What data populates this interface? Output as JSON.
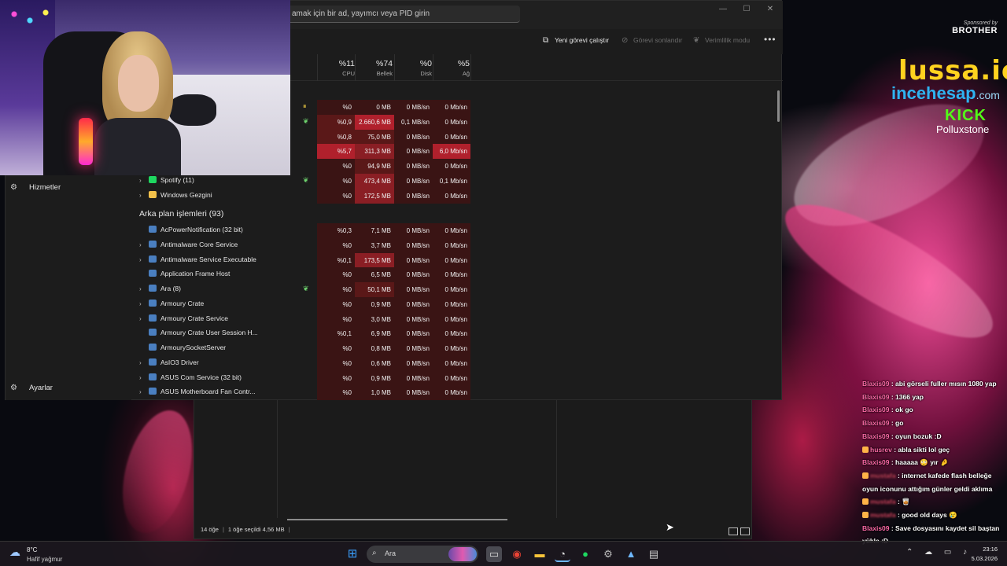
{
  "window": {
    "search_placeholder": "amak için bir ad, yayımcı veya PID girin",
    "minimize": "—",
    "maximize": "☐",
    "close": "✕"
  },
  "toolbar": {
    "new_task": "Yeni görevi çalıştır",
    "end_task": "Görevi sonlandır",
    "efficiency": "Verimlilik modu",
    "more": "•••"
  },
  "nav": {
    "services": "Hizmetler",
    "settings": "Ayarlar"
  },
  "columns": {
    "cpu": {
      "pct": "%11",
      "label": "CPU"
    },
    "memory": {
      "pct": "%74",
      "label": "Bellek"
    },
    "disk": {
      "pct": "%0",
      "label": "Disk"
    },
    "network": {
      "pct": "%5",
      "label": "Ağ"
    }
  },
  "apps_rows": [
    {
      "name": "",
      "status": "pause",
      "cpu": "%0",
      "mem": "0 MB",
      "disk": "0 MB/sn",
      "net": "0 Mb/sn"
    },
    {
      "name": "",
      "status": "leaf",
      "cpu": "%0,9",
      "mem": "2.660,6 MB",
      "disk": "0,1 MB/sn",
      "net": "0 Mb/sn"
    },
    {
      "name": "",
      "status": "",
      "cpu": "%0,8",
      "mem": "75,0 MB",
      "disk": "0 MB/sn",
      "net": "0 Mb/sn"
    },
    {
      "name": "",
      "status": "",
      "cpu": "%5,7",
      "mem": "311,3 MB",
      "disk": "0 MB/sn",
      "net": "6,0 Mb/sn"
    },
    {
      "name": "",
      "status": "",
      "cpu": "%0",
      "mem": "94,9 MB",
      "disk": "0 MB/sn",
      "net": "0 Mb/sn"
    },
    {
      "name": "Spotify (11)",
      "status": "leaf",
      "cpu": "%0",
      "mem": "473,4 MB",
      "disk": "0 MB/sn",
      "net": "0,1 Mb/sn"
    },
    {
      "name": "Windows Gezgini",
      "status": "",
      "cpu": "%0",
      "mem": "172,5 MB",
      "disk": "0 MB/sn",
      "net": "0 Mb/sn"
    }
  ],
  "background_title": "Arka plan işlemleri (93)",
  "background_rows": [
    {
      "name": "AcPowerNotification (32 bit)",
      "expand": false,
      "status": "",
      "cpu": "%0,3",
      "mem": "7,1 MB",
      "disk": "0 MB/sn",
      "net": "0 Mb/sn"
    },
    {
      "name": "Antimalware Core Service",
      "expand": true,
      "status": "",
      "cpu": "%0",
      "mem": "3,7 MB",
      "disk": "0 MB/sn",
      "net": "0 Mb/sn"
    },
    {
      "name": "Antimalware Service Executable",
      "expand": true,
      "status": "",
      "cpu": "%0,1",
      "mem": "173,5 MB",
      "disk": "0 MB/sn",
      "net": "0 Mb/sn"
    },
    {
      "name": "Application Frame Host",
      "expand": false,
      "status": "",
      "cpu": "%0",
      "mem": "6,5 MB",
      "disk": "0 MB/sn",
      "net": "0 Mb/sn"
    },
    {
      "name": "Ara (8)",
      "expand": true,
      "status": "leaf",
      "cpu": "%0",
      "mem": "50,1 MB",
      "disk": "0 MB/sn",
      "net": "0 Mb/sn"
    },
    {
      "name": "Armoury Crate",
      "expand": true,
      "status": "",
      "cpu": "%0",
      "mem": "0,9 MB",
      "disk": "0 MB/sn",
      "net": "0 Mb/sn"
    },
    {
      "name": "Armoury Crate Service",
      "expand": true,
      "status": "",
      "cpu": "%0",
      "mem": "3,0 MB",
      "disk": "0 MB/sn",
      "net": "0 Mb/sn"
    },
    {
      "name": "Armoury Crate User Session H...",
      "expand": false,
      "status": "",
      "cpu": "%0,1",
      "mem": "6,9 MB",
      "disk": "0 MB/sn",
      "net": "0 Mb/sn"
    },
    {
      "name": "ArmourySocketServer",
      "expand": false,
      "status": "",
      "cpu": "%0",
      "mem": "0,8 MB",
      "disk": "0 MB/sn",
      "net": "0 Mb/sn"
    },
    {
      "name": "AsIO3 Driver",
      "expand": true,
      "status": "",
      "cpu": "%0",
      "mem": "0,6 MB",
      "disk": "0 MB/sn",
      "net": "0 Mb/sn"
    },
    {
      "name": "ASUS Com Service (32 bit)",
      "expand": true,
      "status": "",
      "cpu": "%0",
      "mem": "0,9 MB",
      "disk": "0 MB/sn",
      "net": "0 Mb/sn"
    },
    {
      "name": "ASUS Motherboard Fan Contr...",
      "expand": true,
      "status": "",
      "cpu": "%0",
      "mem": "1,0 MB",
      "disk": "0 MB/sn",
      "net": "0 Mb/sn"
    }
  ],
  "status_bar": {
    "items": "14 öğe",
    "selected": "1 öğe seçildi  4,56 MB",
    "tail": "|"
  },
  "overlay": {
    "sponsored": "Sponsored by",
    "brand": "BROTHER",
    "lussa": "lussa.io",
    "ince_a": "ince",
    "ince_b": "hesap",
    "ince_c": ".com",
    "kick": "KICK",
    "channel": "Polluxstone"
  },
  "chat": [
    {
      "user": "Blaxis09",
      "blur": false,
      "badge": false,
      "text": " : abi görseli fuller mısın 1080 yap"
    },
    {
      "user": "Blaxis09",
      "blur": false,
      "badge": false,
      "text": " : 1366 yap"
    },
    {
      "user": "Blaxis09",
      "blur": false,
      "badge": false,
      "text": " : ok go"
    },
    {
      "user": "Blaxis09",
      "blur": false,
      "badge": false,
      "text": " : go"
    },
    {
      "user": "Blaxis09",
      "blur": false,
      "badge": false,
      "text": " : oyun bozuk :D"
    },
    {
      "user": "husrev",
      "blur": false,
      "badge": true,
      "text": " : abla sikti lol geç"
    },
    {
      "user": "Blaxis09",
      "blur": false,
      "badge": false,
      "text": " : haaaaa 😳 yır 🤌"
    },
    {
      "user": "mustafa",
      "blur": true,
      "badge": true,
      "text": " : internet kafede flash belleğe oyun iconunu attığım günler geldi aklıma"
    },
    {
      "user": "mustafa",
      "blur": true,
      "badge": true,
      "text": " : 🥃"
    },
    {
      "user": "mustafa",
      "blur": true,
      "badge": true,
      "text": " : good old days 😢"
    },
    {
      "user": "Blaxis09",
      "blur": false,
      "badge": false,
      "text": " : Save dosyasını kaydet sil baştan yükle :D"
    }
  ],
  "taskbar": {
    "temp": "8°C",
    "weather": "Hafif yağmur",
    "search": "Ara",
    "time": "23:16",
    "date": "5.03.2026"
  },
  "colors": {
    "heat_low": "#3a1414",
    "heat_mid": "#5a1818",
    "heat_high": "#8a1e24",
    "heat_max": "#b0202c",
    "accent_green": "#6ed36e",
    "chat_user": "#ff6aa8"
  }
}
